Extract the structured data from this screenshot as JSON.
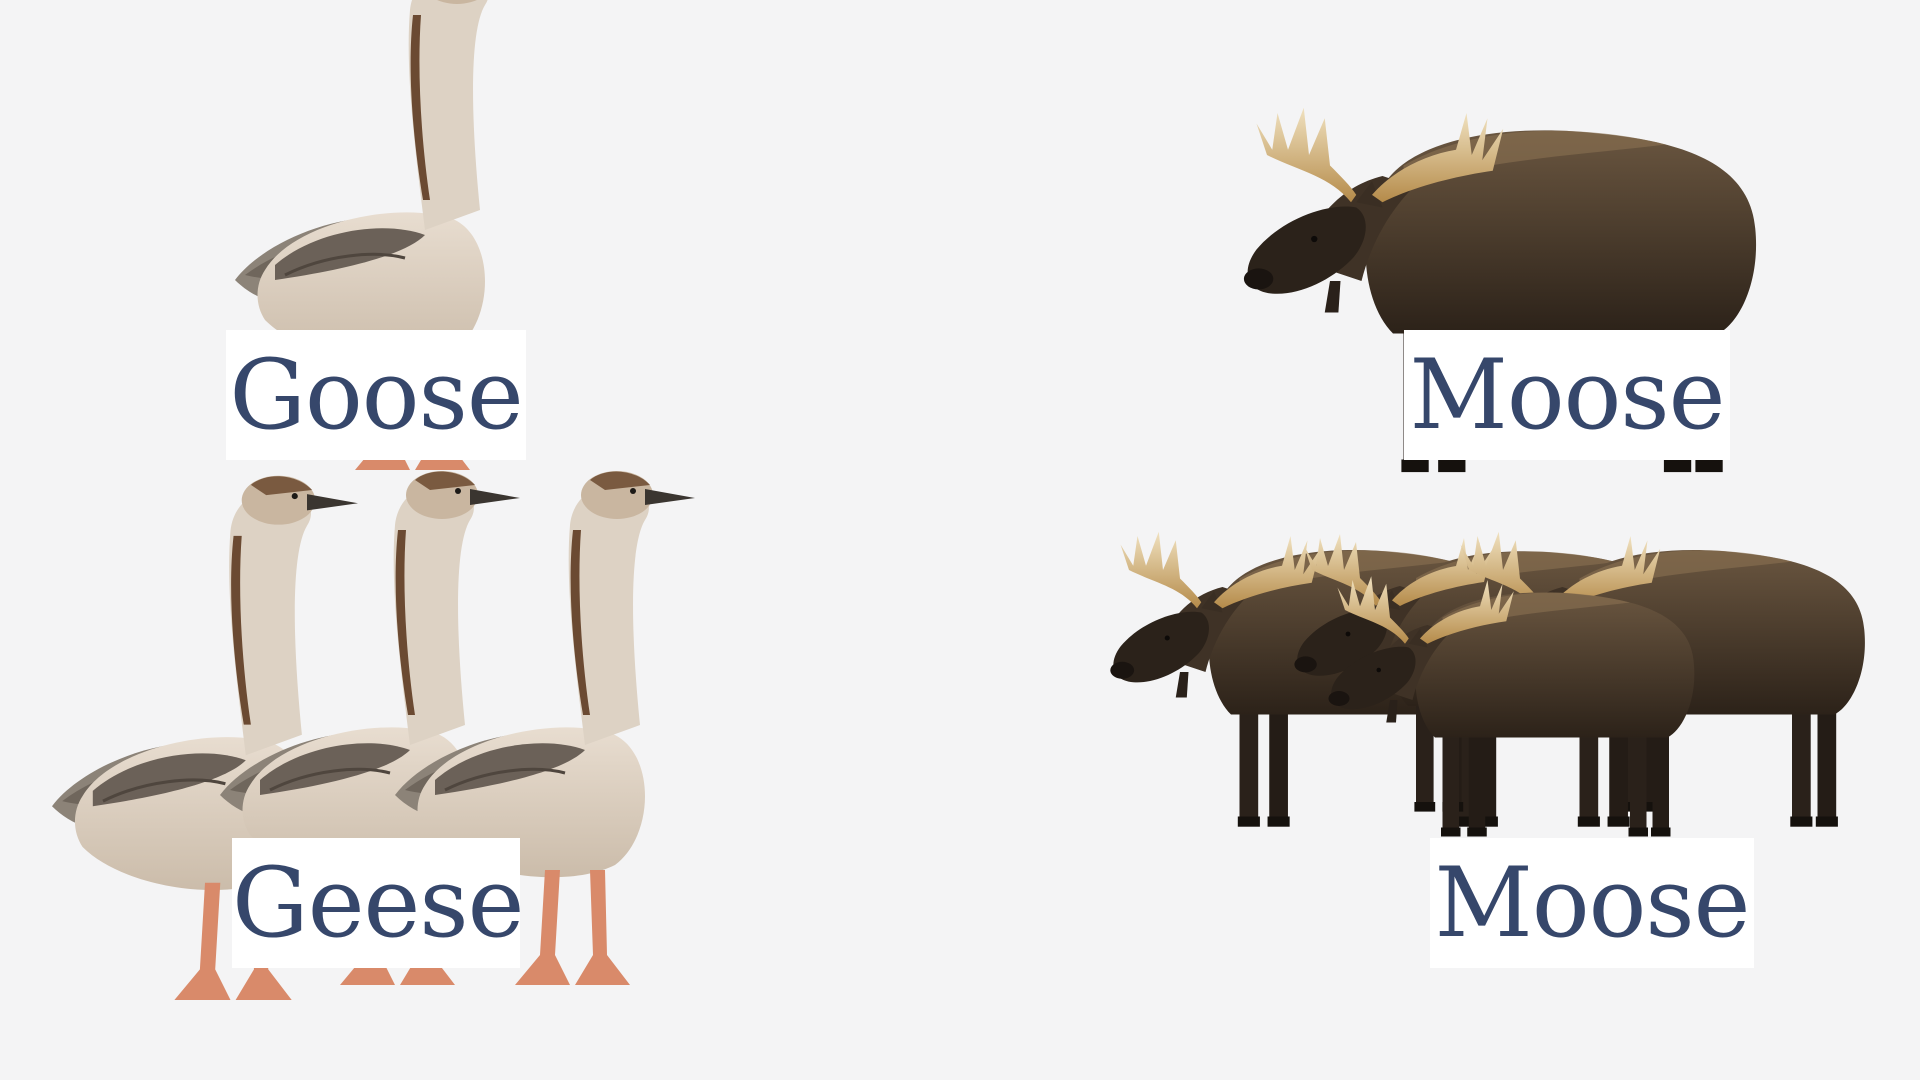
{
  "slide": {
    "background": "#f4f4f5",
    "text_color": "#36476b",
    "panels": [
      {
        "label": "Goose",
        "image": "goose-illustration",
        "count": 1
      },
      {
        "label": "Moose",
        "image": "moose-illustration",
        "count": 1
      },
      {
        "label": "Geese",
        "image": "geese-illustration",
        "count": 3
      },
      {
        "label": "Moose",
        "image": "moose-herd-illustration",
        "count": 4
      }
    ]
  }
}
